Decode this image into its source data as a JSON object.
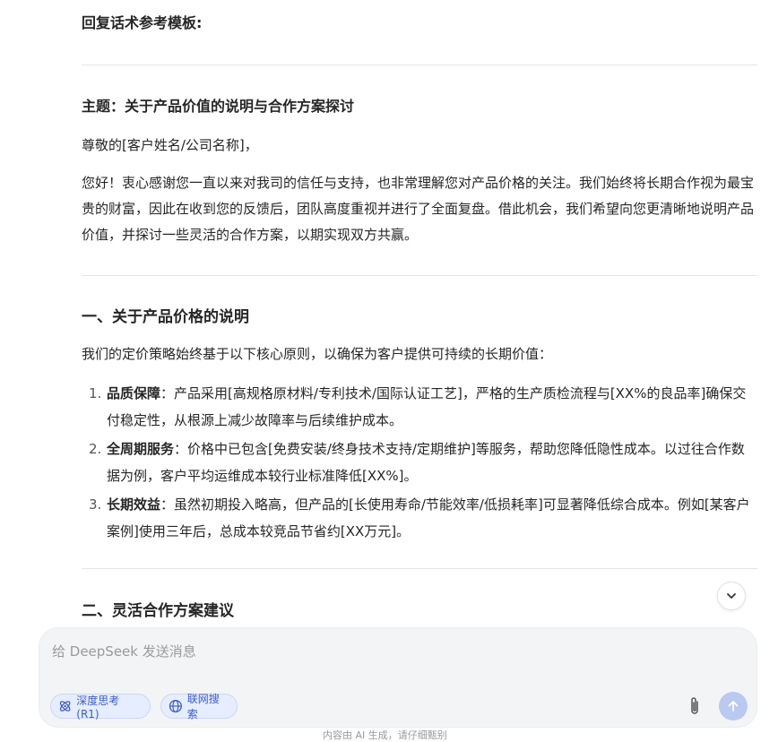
{
  "document": {
    "template_heading": "回复话术参考模板:",
    "subject": "主题：关于产品价值的说明与合作方案探讨",
    "greeting": "尊敬的[客户姓名/公司名称]，",
    "body": "您好！衷心感谢您一直以来对我司的信任与支持，也非常理解您对产品价格的关注。我们始终将长期合作视为最宝贵的财富，因此在收到您的反馈后，团队高度重视并进行了全面复盘。借此机会，我们希望向您更清晰地说明产品价值，并探讨一些灵活的合作方案，以期实现双方共赢。",
    "section1_title": "一、关于产品价格的说明",
    "section1_intro": "我们的定价策略始终基于以下核心原则，以确保为客户提供可持续的长期价值：",
    "section1_items": [
      {
        "num": "1.",
        "label": "品质保障",
        "text": "：产品采用[高规格原材料/专利技术/国际认证工艺]，严格的生产质检流程与[XX%的良品率]确保交付稳定性，从根源上减少故障率与后续维护成本。"
      },
      {
        "num": "2.",
        "label": "全周期服务",
        "text": "：价格中已包含[免费安装/终身技术支持/定期维护]等服务，帮助您降低隐性成本。以过往合作数据为例，客户平均运维成本较行业标准降低[XX%]。"
      },
      {
        "num": "3.",
        "label": "长期效益",
        "text": "：虽然初期投入略高，但产品的[长使用寿命/节能效率/低损耗率]可显著降低综合成本。例如[某客户案例]使用三年后，总成本较竞品节省约[XX万元]。"
      }
    ],
    "section2_title": "二、灵活合作方案建议"
  },
  "composer": {
    "placeholder": "给 DeepSeek 发送消息",
    "deep_think_label": "深度思考 (R1)",
    "web_search_label": "联网搜索"
  },
  "footer": {
    "text": "内容由 AI 生成，请仔细甄别"
  },
  "icons": {
    "scroll_down": "chevron-down-icon",
    "deep_think": "atom-icon",
    "web_search": "globe-icon",
    "attach": "paperclip-icon",
    "send": "arrow-up-icon"
  },
  "colors": {
    "chip_text": "#3b5ccc",
    "chip_bg": "#e6edff",
    "send_bg": "#b9c9f2",
    "composer_bg": "#f3f4f6"
  }
}
